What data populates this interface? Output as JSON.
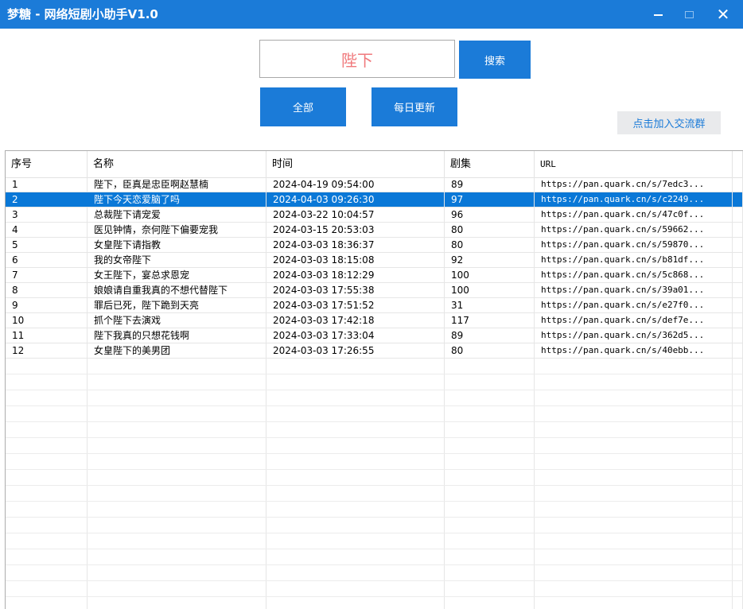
{
  "window": {
    "title": "梦糖 - 网络短剧小助手V1.0",
    "min": "",
    "max": "",
    "close": "✕"
  },
  "search": {
    "value": "陛下",
    "button": "搜索"
  },
  "buttons": {
    "all": "全部",
    "daily": "每日更新",
    "join": "点击加入交流群"
  },
  "table": {
    "columns": [
      "序号",
      "名称",
      "时间",
      "剧集",
      "URL"
    ],
    "selected_index": 1,
    "rows": [
      [
        "1",
        "陛下，臣真是忠臣啊赵慧楠",
        "2024-04-19 09:54:00",
        "89",
        "https://pan.quark.cn/s/7edc3..."
      ],
      [
        "2",
        "陛下今天恋爱脑了吗",
        "2024-04-03 09:26:30",
        "97",
        "https://pan.quark.cn/s/c2249..."
      ],
      [
        "3",
        "总裁陛下请宠爱",
        "2024-03-22 10:04:57",
        "96",
        "https://pan.quark.cn/s/47c0f..."
      ],
      [
        "4",
        "医见钟情，奈何陛下偏要宠我",
        "2024-03-15 20:53:03",
        "80",
        "https://pan.quark.cn/s/59662..."
      ],
      [
        "5",
        "女皇陛下请指教",
        "2024-03-03 18:36:37",
        "80",
        "https://pan.quark.cn/s/59870..."
      ],
      [
        "6",
        "我的女帝陛下",
        "2024-03-03 18:15:08",
        "92",
        "https://pan.quark.cn/s/b81df..."
      ],
      [
        "7",
        "女王陛下，宴总求恩宠",
        "2024-03-03 18:12:29",
        "100",
        "https://pan.quark.cn/s/5c868..."
      ],
      [
        "8",
        "娘娘请自重我真的不想代替陛下",
        "2024-03-03 17:55:38",
        "100",
        "https://pan.quark.cn/s/39a01..."
      ],
      [
        "9",
        "罪后已死，陛下跪到天亮",
        "2024-03-03 17:51:52",
        "31",
        "https://pan.quark.cn/s/e27f0..."
      ],
      [
        "10",
        "抓个陛下去演戏",
        "2024-03-03 17:42:18",
        "117",
        "https://pan.quark.cn/s/def7e..."
      ],
      [
        "11",
        "陛下我真的只想花钱啊",
        "2024-03-03 17:33:04",
        "89",
        "https://pan.quark.cn/s/362d5..."
      ],
      [
        "12",
        "女皇陛下的美男团",
        "2024-03-03 17:26:55",
        "80",
        "https://pan.quark.cn/s/40ebb..."
      ]
    ]
  },
  "colors": {
    "accent": "#1b7bd8",
    "selected_row": "#0a78d7",
    "search_text": "#f0797c"
  }
}
